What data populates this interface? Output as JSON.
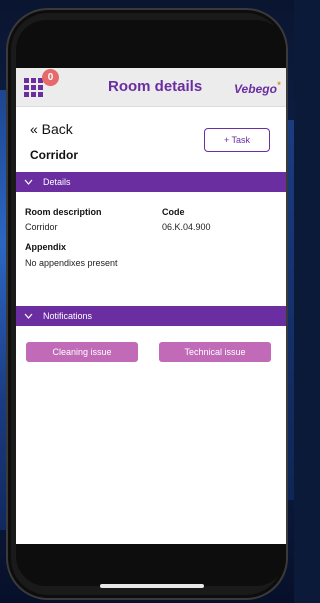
{
  "header": {
    "title": "Room details",
    "brand": "Vebego",
    "brand_mark": "*",
    "notification_count": "0"
  },
  "nav": {
    "back_label": "« Back",
    "task_button_label": "+ Task"
  },
  "room": {
    "name": "Corridor"
  },
  "details": {
    "section_title": "Details",
    "room_description_label": "Room description",
    "room_description_value": "Corridor",
    "code_label": "Code",
    "code_value": "06.K.04.900",
    "appendix_label": "Appendix",
    "appendix_value": "No appendixes present"
  },
  "notifications": {
    "section_title": "Notifications",
    "cleaning_issue_label": "Cleaning issue",
    "technical_issue_label": "Technical issue"
  },
  "colors": {
    "accent": "#6a2ea0",
    "pill": "#c06ab8",
    "badge": "#e56a6a"
  }
}
